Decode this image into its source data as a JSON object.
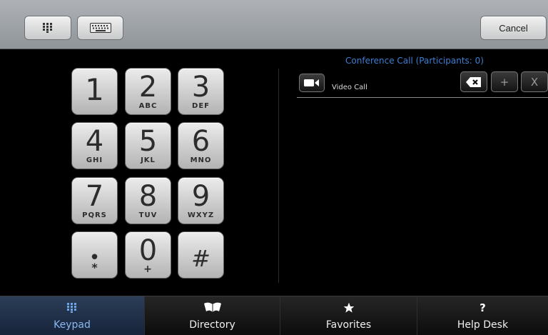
{
  "topbar": {
    "keypad_icon": "keypad-grid-icon",
    "keyboard_icon": "keyboard-icon",
    "cancel_label": "Cancel"
  },
  "keypad": {
    "keys": [
      {
        "digit": "1",
        "letters": ""
      },
      {
        "digit": "2",
        "letters": "ABC"
      },
      {
        "digit": "3",
        "letters": "DEF"
      },
      {
        "digit": "4",
        "letters": "GHI"
      },
      {
        "digit": "5",
        "letters": "JKL"
      },
      {
        "digit": "6",
        "letters": "MNO"
      },
      {
        "digit": "7",
        "letters": "PQRS"
      },
      {
        "digit": "8",
        "letters": "TUV"
      },
      {
        "digit": "9",
        "letters": "WXYZ"
      },
      {
        "digit": "•",
        "letters": "*"
      },
      {
        "digit": "0",
        "letters": "+"
      },
      {
        "digit": "#",
        "letters": ""
      }
    ]
  },
  "call_panel": {
    "title": "Conference Call (Participants: 0)",
    "video_label": "Video Call",
    "video_icon": "video-camera-icon",
    "backspace_icon": "backspace-icon",
    "plus_label": "+",
    "x_label": "X",
    "number_value": ""
  },
  "bottom_nav": {
    "items": [
      {
        "label": "Keypad",
        "icon": "keypad-grid-icon",
        "active": true
      },
      {
        "label": "Directory",
        "icon": "book-icon",
        "active": false
      },
      {
        "label": "Favorites",
        "icon": "star-icon",
        "active": false
      },
      {
        "label": "Help Desk",
        "icon": "question-icon",
        "active": false
      }
    ]
  },
  "colors": {
    "accent": "#3f7fd2",
    "active_nav_label": "#8ab8f0"
  }
}
